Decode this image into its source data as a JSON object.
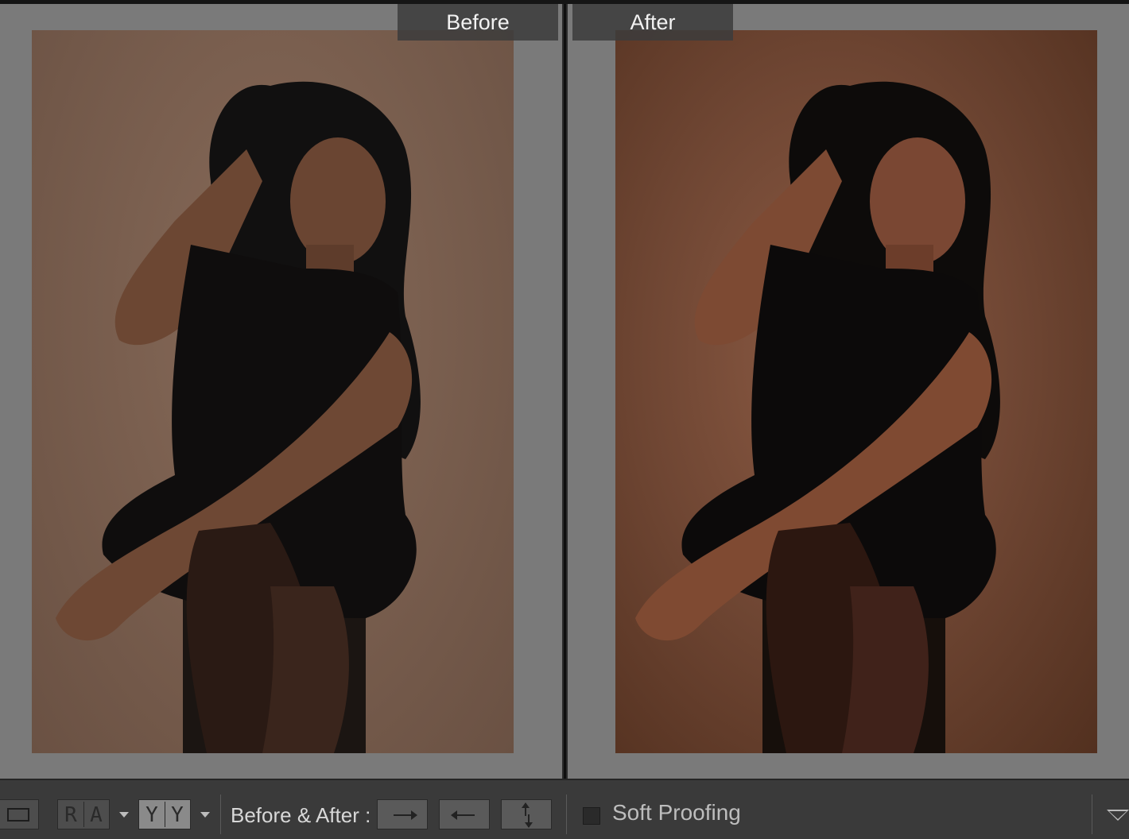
{
  "panes": {
    "before_label": "Before",
    "after_label": "After"
  },
  "photos": {
    "before": {
      "description_icon": "portrait-photo",
      "tone": "#7a5f4f"
    },
    "after": {
      "description_icon": "portrait-photo",
      "tone": "#6f4633"
    }
  },
  "toolbar": {
    "loupe_icon": "loupe-view-icon",
    "ra_letters": [
      "R",
      "A"
    ],
    "yy_letters": [
      "Y",
      "Y"
    ],
    "before_after_label": "Before & After :",
    "copy_before_to_after_icon": "arrow-right-icon",
    "copy_after_to_before_icon": "arrow-left-icon",
    "swap_icon": "swap-vertical-icon",
    "soft_proofing_label": "Soft Proofing",
    "soft_proofing_checked": false,
    "menu_icon": "toolbar-menu-triangle-icon"
  },
  "colors": {
    "pane_bg": "#7a7a7a",
    "toolbar_bg": "#3a3a3a",
    "label_bg": "#3c3c3c"
  }
}
